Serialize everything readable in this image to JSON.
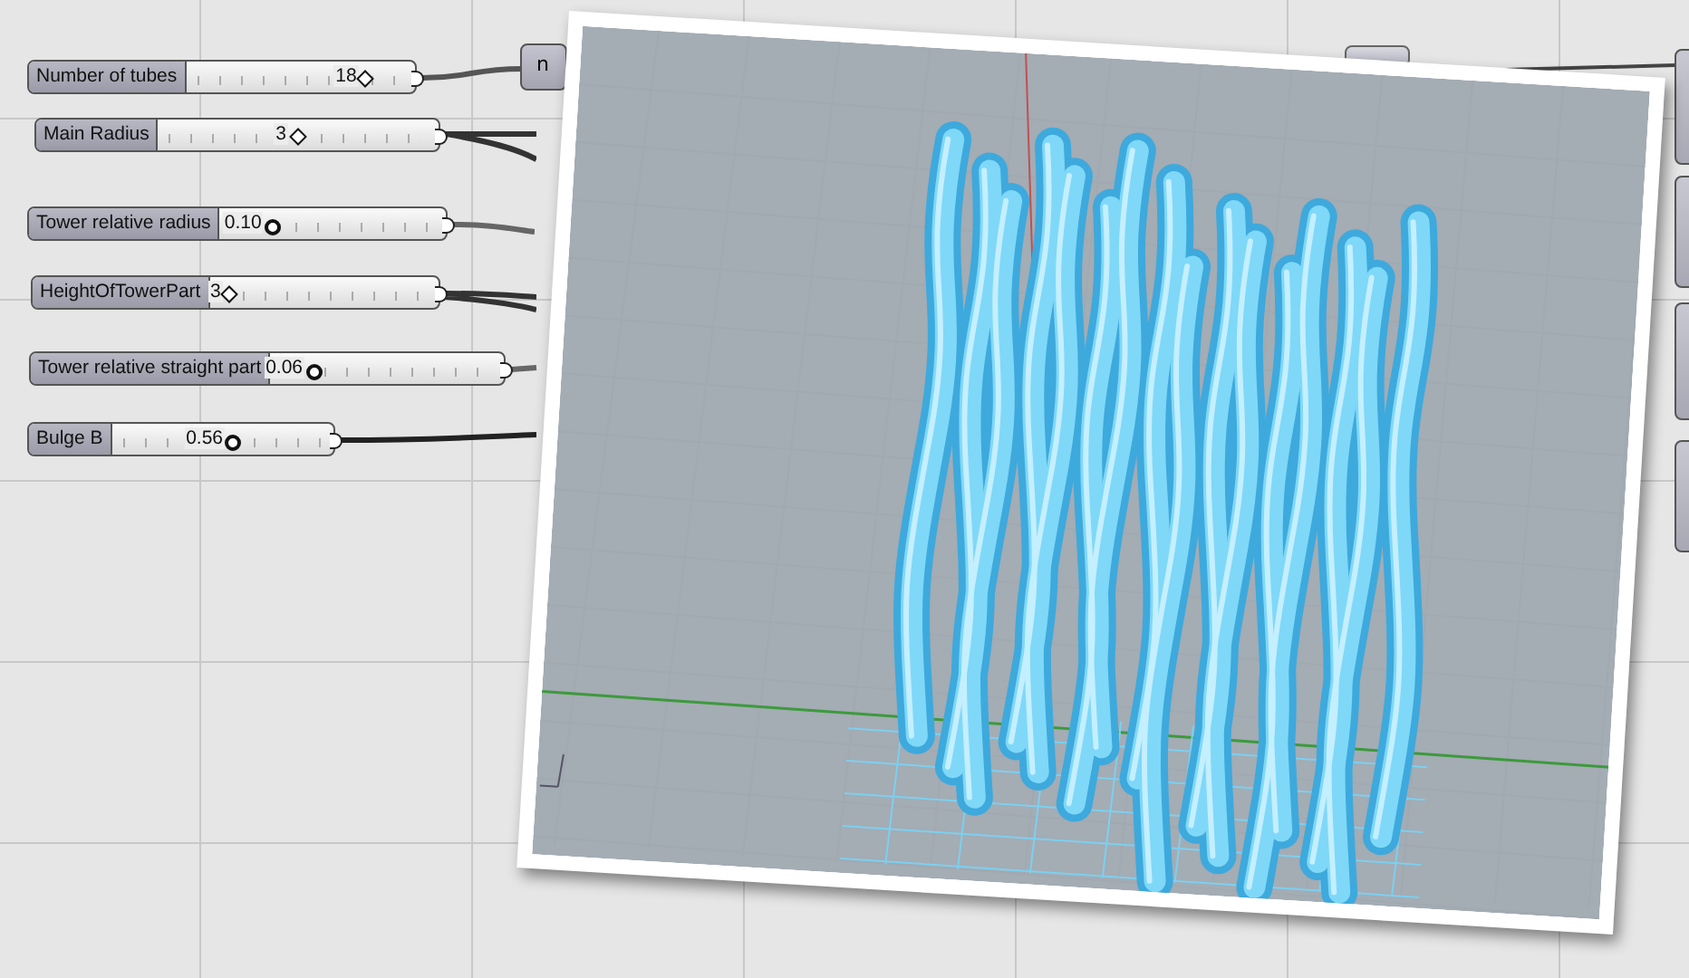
{
  "sliders": [
    {
      "label": "Number of tubes",
      "value": "18",
      "level": 0.82,
      "kind": "integer"
    },
    {
      "label": "Main Radius",
      "value": "3",
      "level": 0.5,
      "kind": "integer"
    },
    {
      "label": "Tower relative radius",
      "value": "0.10",
      "level": 0.2,
      "kind": "float"
    },
    {
      "label": "HeightOfTowerPart",
      "value": "3",
      "level": 0.05,
      "kind": "integer"
    },
    {
      "label": "Tower relative straight part",
      "value": "0.06",
      "level": 0.15,
      "kind": "float"
    },
    {
      "label": "Bulge B",
      "value": "0.56",
      "level": 0.55,
      "kind": "float"
    }
  ],
  "input_node": {
    "label": "n"
  }
}
